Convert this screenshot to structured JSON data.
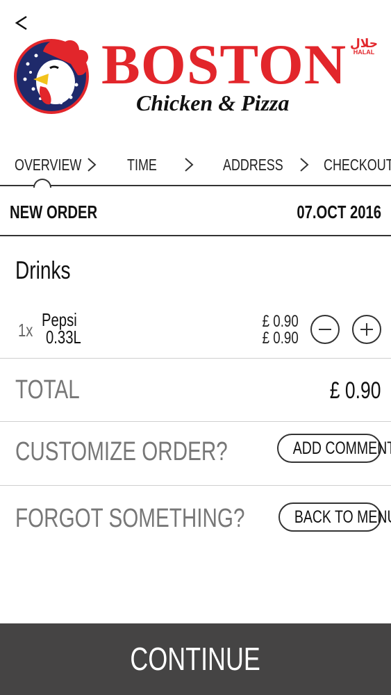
{
  "header": {
    "back_icon": "chevron-left-icon",
    "logo": {
      "name": "BOSTON",
      "subtitle": "Chicken & Pizza",
      "halal_arabic": "حلال",
      "halal_label": "HALAL"
    }
  },
  "stepper": {
    "steps": [
      "OVERVIEW",
      "TIME",
      "ADDRESS",
      "CHECKOUT"
    ],
    "active": "OVERVIEW"
  },
  "order": {
    "label": "NEW ORDER",
    "date": "07.OCT 2016"
  },
  "category": {
    "title": "Drinks",
    "items": [
      {
        "qty": "1x",
        "name_line1": "Pepsi",
        "name_line2": "0.33L",
        "unit_price": "£ 0.90",
        "line_price": "£ 0.90"
      }
    ]
  },
  "total": {
    "label": "TOTAL",
    "value": "£ 0.90"
  },
  "customize": {
    "label": "CUSTOMIZE ORDER?",
    "button": "ADD COMMENT"
  },
  "forgot": {
    "label": "FORGOT SOMETHING?",
    "button": "BACK TO MENU"
  },
  "footer": {
    "continue": "CONTINUE"
  },
  "colors": {
    "brand_red": "#e2262b",
    "footer_bg": "#454444",
    "muted_text": "#777777"
  }
}
